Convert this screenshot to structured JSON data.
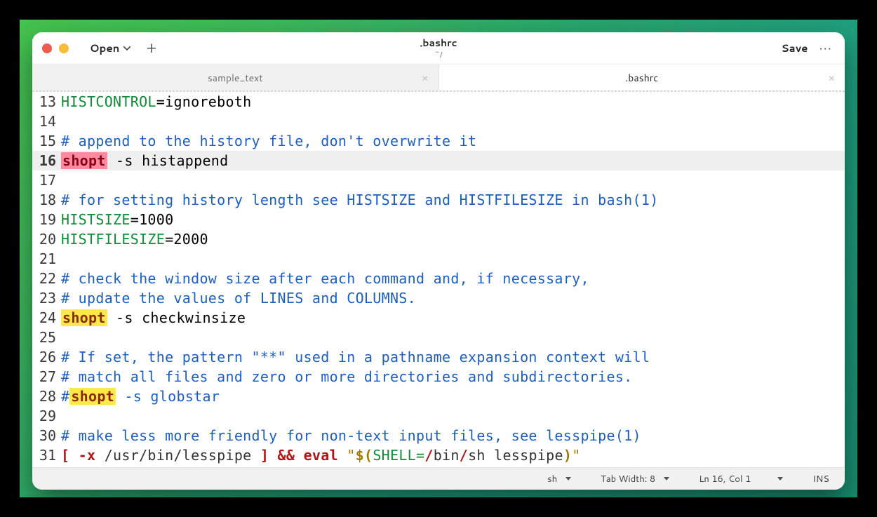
{
  "titlebar": {
    "open_label": "Open",
    "filename": ".bashrc",
    "filepath": "~/",
    "save_label": "Save"
  },
  "tabs": [
    {
      "label": "sample_text",
      "active": false
    },
    {
      "label": ".bashrc",
      "active": true
    }
  ],
  "editor": {
    "first_line": 13,
    "current_line": 16,
    "lines": [
      {
        "n": 13,
        "tokens": [
          {
            "t": "HISTCONTROL",
            "c": "tk-var"
          },
          {
            "t": "=ignoreboth"
          }
        ]
      },
      {
        "n": 14,
        "tokens": []
      },
      {
        "n": 15,
        "tokens": [
          {
            "t": "# append to the history file, don't overwrite it",
            "c": "tk-cmt"
          }
        ]
      },
      {
        "n": 16,
        "tokens": [
          {
            "t": "shopt",
            "c": "hl-pink"
          },
          {
            "t": " -s histappend"
          }
        ]
      },
      {
        "n": 17,
        "tokens": []
      },
      {
        "n": 18,
        "tokens": [
          {
            "t": "# for setting history length see HISTSIZE and HISTFILESIZE in bash(1)",
            "c": "tk-cmt"
          }
        ]
      },
      {
        "n": 19,
        "tokens": [
          {
            "t": "HISTSIZE",
            "c": "tk-var"
          },
          {
            "t": "=1000"
          }
        ]
      },
      {
        "n": 20,
        "tokens": [
          {
            "t": "HISTFILESIZE",
            "c": "tk-var"
          },
          {
            "t": "=2000"
          }
        ]
      },
      {
        "n": 21,
        "tokens": []
      },
      {
        "n": 22,
        "tokens": [
          {
            "t": "# check the window size after each command and, if necessary,",
            "c": "tk-cmt"
          }
        ]
      },
      {
        "n": 23,
        "tokens": [
          {
            "t": "# update the values of LINES and COLUMNS.",
            "c": "tk-cmt"
          }
        ]
      },
      {
        "n": 24,
        "tokens": [
          {
            "t": "shopt",
            "c": "hl-yel"
          },
          {
            "t": " -s checkwinsize"
          }
        ]
      },
      {
        "n": 25,
        "tokens": []
      },
      {
        "n": 26,
        "tokens": [
          {
            "t": "# If set, the pattern \"**\" used in a pathname expansion context will",
            "c": "tk-cmt"
          }
        ]
      },
      {
        "n": 27,
        "tokens": [
          {
            "t": "# match all files and zero or more directories and subdirectories.",
            "c": "tk-cmt"
          }
        ]
      },
      {
        "n": 28,
        "tokens": [
          {
            "t": "#",
            "c": "tk-cmt"
          },
          {
            "t": "shopt",
            "c": "hl-yel"
          },
          {
            "t": " -s globstar",
            "c": "tk-cmt"
          }
        ]
      },
      {
        "n": 29,
        "tokens": []
      },
      {
        "n": 30,
        "tokens": [
          {
            "t": "# make less more friendly for non-text input files, see lesspipe(1)",
            "c": "tk-cmt"
          }
        ]
      },
      {
        "n": 31,
        "tokens": [
          {
            "t": "[",
            "c": "tk-punc"
          },
          {
            "t": " -x ",
            "c": "tk-kw"
          },
          {
            "t": "/usr/bin/lesspipe ",
            "c": "tk-path"
          },
          {
            "t": "]",
            "c": "tk-punc"
          },
          {
            "t": " && eval ",
            "c": "tk-op"
          },
          {
            "t": "\"",
            "c": "tk-str"
          },
          {
            "t": "$(",
            "c": "tk-subst"
          },
          {
            "t": "SHELL=",
            "c": "tk-var"
          },
          {
            "t": "/",
            "c": "tk-op"
          },
          {
            "t": "bin",
            "c": "tk-path"
          },
          {
            "t": "/",
            "c": "tk-op"
          },
          {
            "t": "sh lesspipe",
            "c": "tk-path"
          },
          {
            "t": ")",
            "c": "tk-subst"
          },
          {
            "t": "\"",
            "c": "tk-str"
          }
        ]
      }
    ]
  },
  "statusbar": {
    "language": "sh",
    "tabwidth": "Tab Width: 8",
    "position": "Ln 16, Col 1",
    "mode": "INS"
  }
}
